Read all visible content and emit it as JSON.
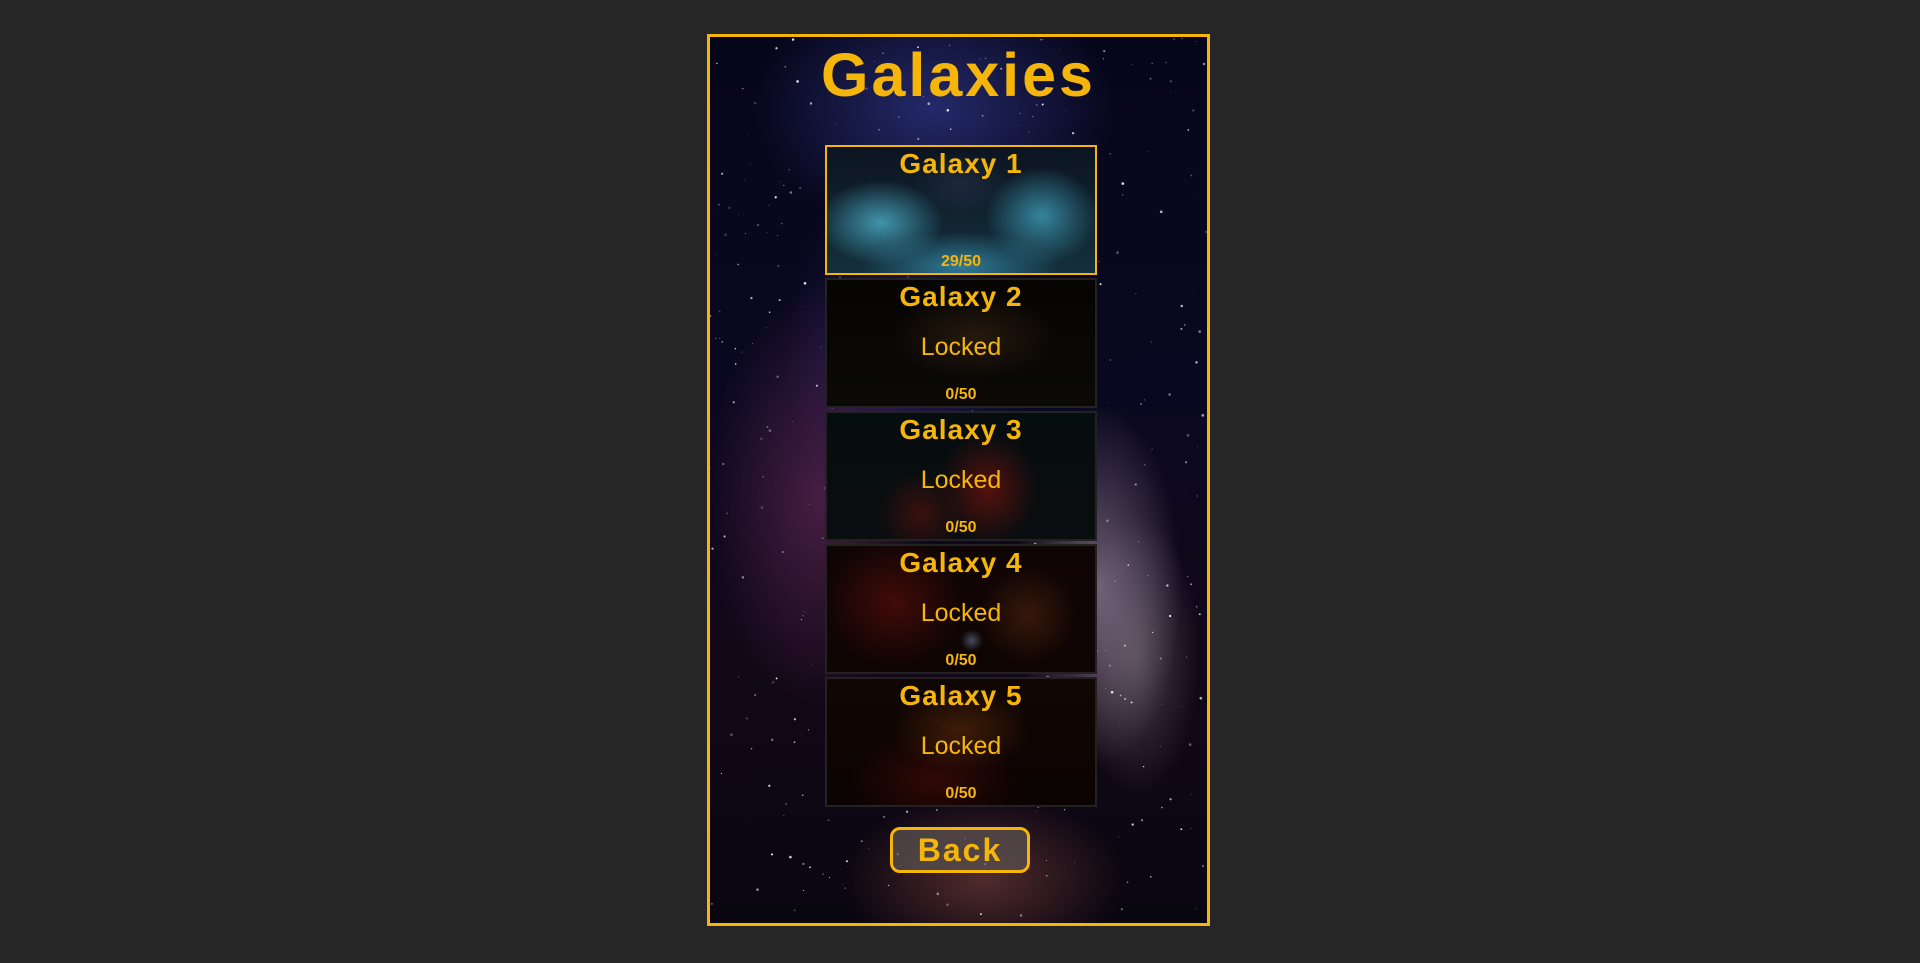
{
  "screen": {
    "title": "Galaxies"
  },
  "galaxies": [
    {
      "name": "Galaxy 1",
      "status": "",
      "progress": "29/50",
      "locked": false
    },
    {
      "name": "Galaxy 2",
      "status": "Locked",
      "progress": "0/50",
      "locked": true
    },
    {
      "name": "Galaxy 3",
      "status": "Locked",
      "progress": "0/50",
      "locked": true
    },
    {
      "name": "Galaxy 4",
      "status": "Locked",
      "progress": "0/50",
      "locked": true
    },
    {
      "name": "Galaxy 5",
      "status": "Locked",
      "progress": "0/50",
      "locked": true
    }
  ],
  "back_button": {
    "label": "Back"
  },
  "colors": {
    "accent": "#f5b50a",
    "page_background": "#262626"
  }
}
